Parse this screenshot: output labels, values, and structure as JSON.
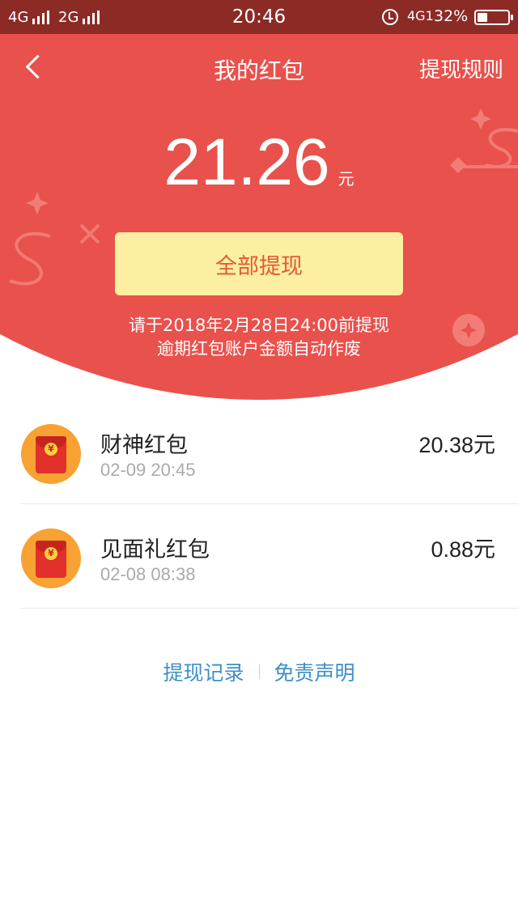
{
  "status_bar": {
    "sim1": "4G",
    "sim2": "2G",
    "time": "20:46",
    "network": "4G1",
    "battery_pct": "32%",
    "battery_level": 0.32
  },
  "header": {
    "title": "我的红包",
    "rules_label": "提现规则"
  },
  "balance": {
    "amount": "21.26",
    "unit": "元"
  },
  "withdraw_all_label": "全部提现",
  "notice": {
    "line1": "请于2018年2月28日24:00前提现",
    "line2": "逾期红包账户金额自动作废"
  },
  "envelope_symbol": "¥",
  "envelopes": [
    {
      "name": "财神红包",
      "time": "02-09 20:45",
      "amount": "20.38元"
    },
    {
      "name": "见面礼红包",
      "time": "02-08 08:38",
      "amount": "0.88元"
    }
  ],
  "footer": {
    "history_label": "提现记录",
    "disclaimer_label": "免责声明"
  },
  "colors": {
    "header_red": "#e9514c",
    "status_bar": "#8c2b25",
    "button_yellow": "#fcefa1",
    "button_text": "#e25a38",
    "link_blue": "#3d8fc9",
    "envelope_orange": "#f7a233"
  }
}
